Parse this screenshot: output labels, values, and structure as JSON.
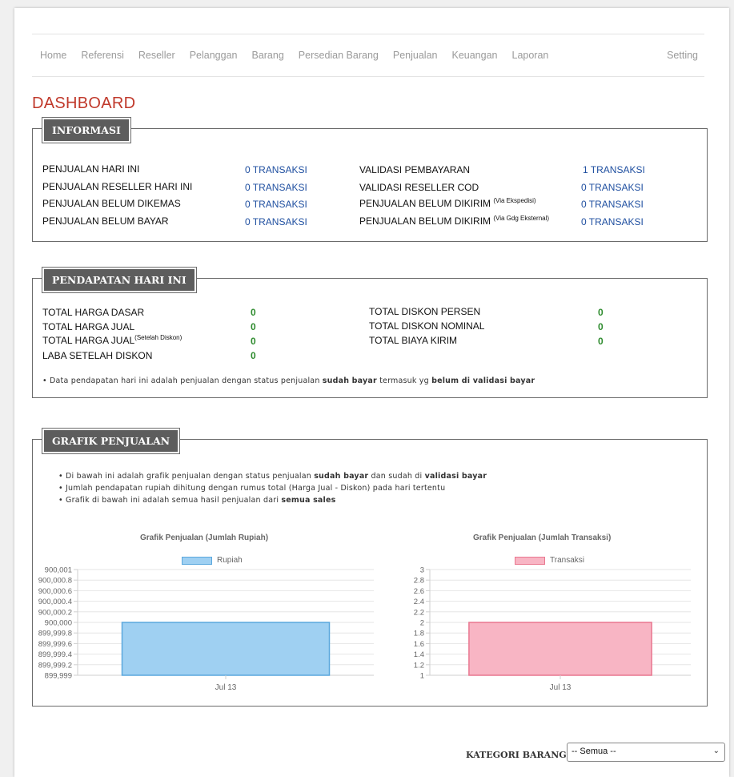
{
  "nav": {
    "items": [
      "Home",
      "Referensi",
      "Reseller",
      "Pelanggan",
      "Barang",
      "Persedian Barang",
      "Penjualan",
      "Keuangan",
      "Laporan"
    ],
    "setting": "Setting"
  },
  "page_title": "DASHBOARD",
  "informasi": {
    "title": "INFORMASI",
    "left": [
      {
        "label": "PENJUALAN HARI INI",
        "value": "0 TRANSAKSI"
      },
      {
        "label": "PENJUALAN RESELLER HARI INI",
        "value": "0 TRANSAKSI"
      },
      {
        "label": "PENJUALAN BELUM DIKEMAS",
        "value": "0 TRANSAKSI"
      },
      {
        "label": "PENJUALAN BELUM BAYAR",
        "value": "0 TRANSAKSI"
      }
    ],
    "right": [
      {
        "label": "VALIDASI PEMBAYARAN",
        "sup": "",
        "value": "1 TRANSAKSI"
      },
      {
        "label": "VALIDASI RESELLER COD",
        "sup": "",
        "value": "0 TRANSAKSI"
      },
      {
        "label": "PENJUALAN BELUM DIKIRIM ",
        "sup": "(Via Ekspedisi)",
        "value": "0 TRANSAKSI"
      },
      {
        "label": "PENJUALAN BELUM DIKIRIM ",
        "sup": "(Via Gdg Eksternal)",
        "value": "0 TRANSAKSI"
      }
    ]
  },
  "pendapatan": {
    "title": "PENDAPATAN HARI INI",
    "left": [
      {
        "label": "TOTAL HARGA DASAR",
        "sup": "",
        "value": "0"
      },
      {
        "label": "TOTAL HARGA JUAL",
        "sup": "",
        "value": "0"
      },
      {
        "label": "TOTAL HARGA JUAL",
        "sup": "(Setelah Diskon)",
        "value": "0"
      },
      {
        "label": "LABA SETELAH DISKON",
        "sup": "",
        "value": "0"
      }
    ],
    "right": [
      {
        "label": "TOTAL DISKON PERSEN",
        "value": "0"
      },
      {
        "label": "TOTAL DISKON NOMINAL",
        "value": "0"
      },
      {
        "label": "TOTAL BIAYA KIRIM",
        "value": "0"
      }
    ],
    "note": {
      "a": "• Data pendapatan hari ini adalah penjualan dengan status penjualan ",
      "b": "sudah bayar",
      "c": " termasuk yg ",
      "d": "belum di validasi bayar"
    }
  },
  "grafik": {
    "title": "GRAFIK PENJUALAN",
    "notes": [
      {
        "a": "• Di bawah ini adalah grafik penjualan dengan status penjualan ",
        "b": "sudah bayar",
        "c": " dan sudah di ",
        "d": "validasi bayar"
      },
      {
        "a": "• Jumlah pendapatan rupiah dihitung dengan rumus total (Harga Jual - Diskon) pada hari tertentu",
        "b": "",
        "c": "",
        "d": ""
      },
      {
        "a": "• Grafik di bawah ini adalah semua hasil penjualan dari ",
        "b": "semua sales",
        "c": "",
        "d": ""
      }
    ]
  },
  "chart_data": [
    {
      "type": "bar",
      "title": "Grafik Penjualan (Jumlah Rupiah)",
      "categories": [
        "Jul 13"
      ],
      "series": [
        {
          "name": "Rupiah",
          "values": [
            900000
          ]
        }
      ],
      "ylim": [
        899999,
        900001
      ],
      "yticks": [
        "900,001",
        "900,000.8",
        "900,000.6",
        "900,000.4",
        "900,000.2",
        "900,000",
        "899,999.8",
        "899,999.6",
        "899,999.4",
        "899,999.2",
        "899,999"
      ],
      "color": "#9fd0f2",
      "border": "#5aa7dd",
      "grid": true,
      "legend": "top"
    },
    {
      "type": "bar",
      "title": "Grafik Penjualan (Jumlah Transaksi)",
      "categories": [
        "Jul 13"
      ],
      "series": [
        {
          "name": "Transaksi",
          "values": [
            2
          ]
        }
      ],
      "ylim": [
        1,
        3
      ],
      "yticks": [
        "3",
        "2.8",
        "2.6",
        "2.4",
        "2.2",
        "2",
        "1.8",
        "1.6",
        "1.4",
        "1.2",
        "1"
      ],
      "color": "#f8b5c4",
      "border": "#e9778f",
      "grid": true,
      "legend": "top"
    }
  ],
  "kategori": {
    "label": "KATEGORI BARANG",
    "selected": "-- Semua --"
  }
}
